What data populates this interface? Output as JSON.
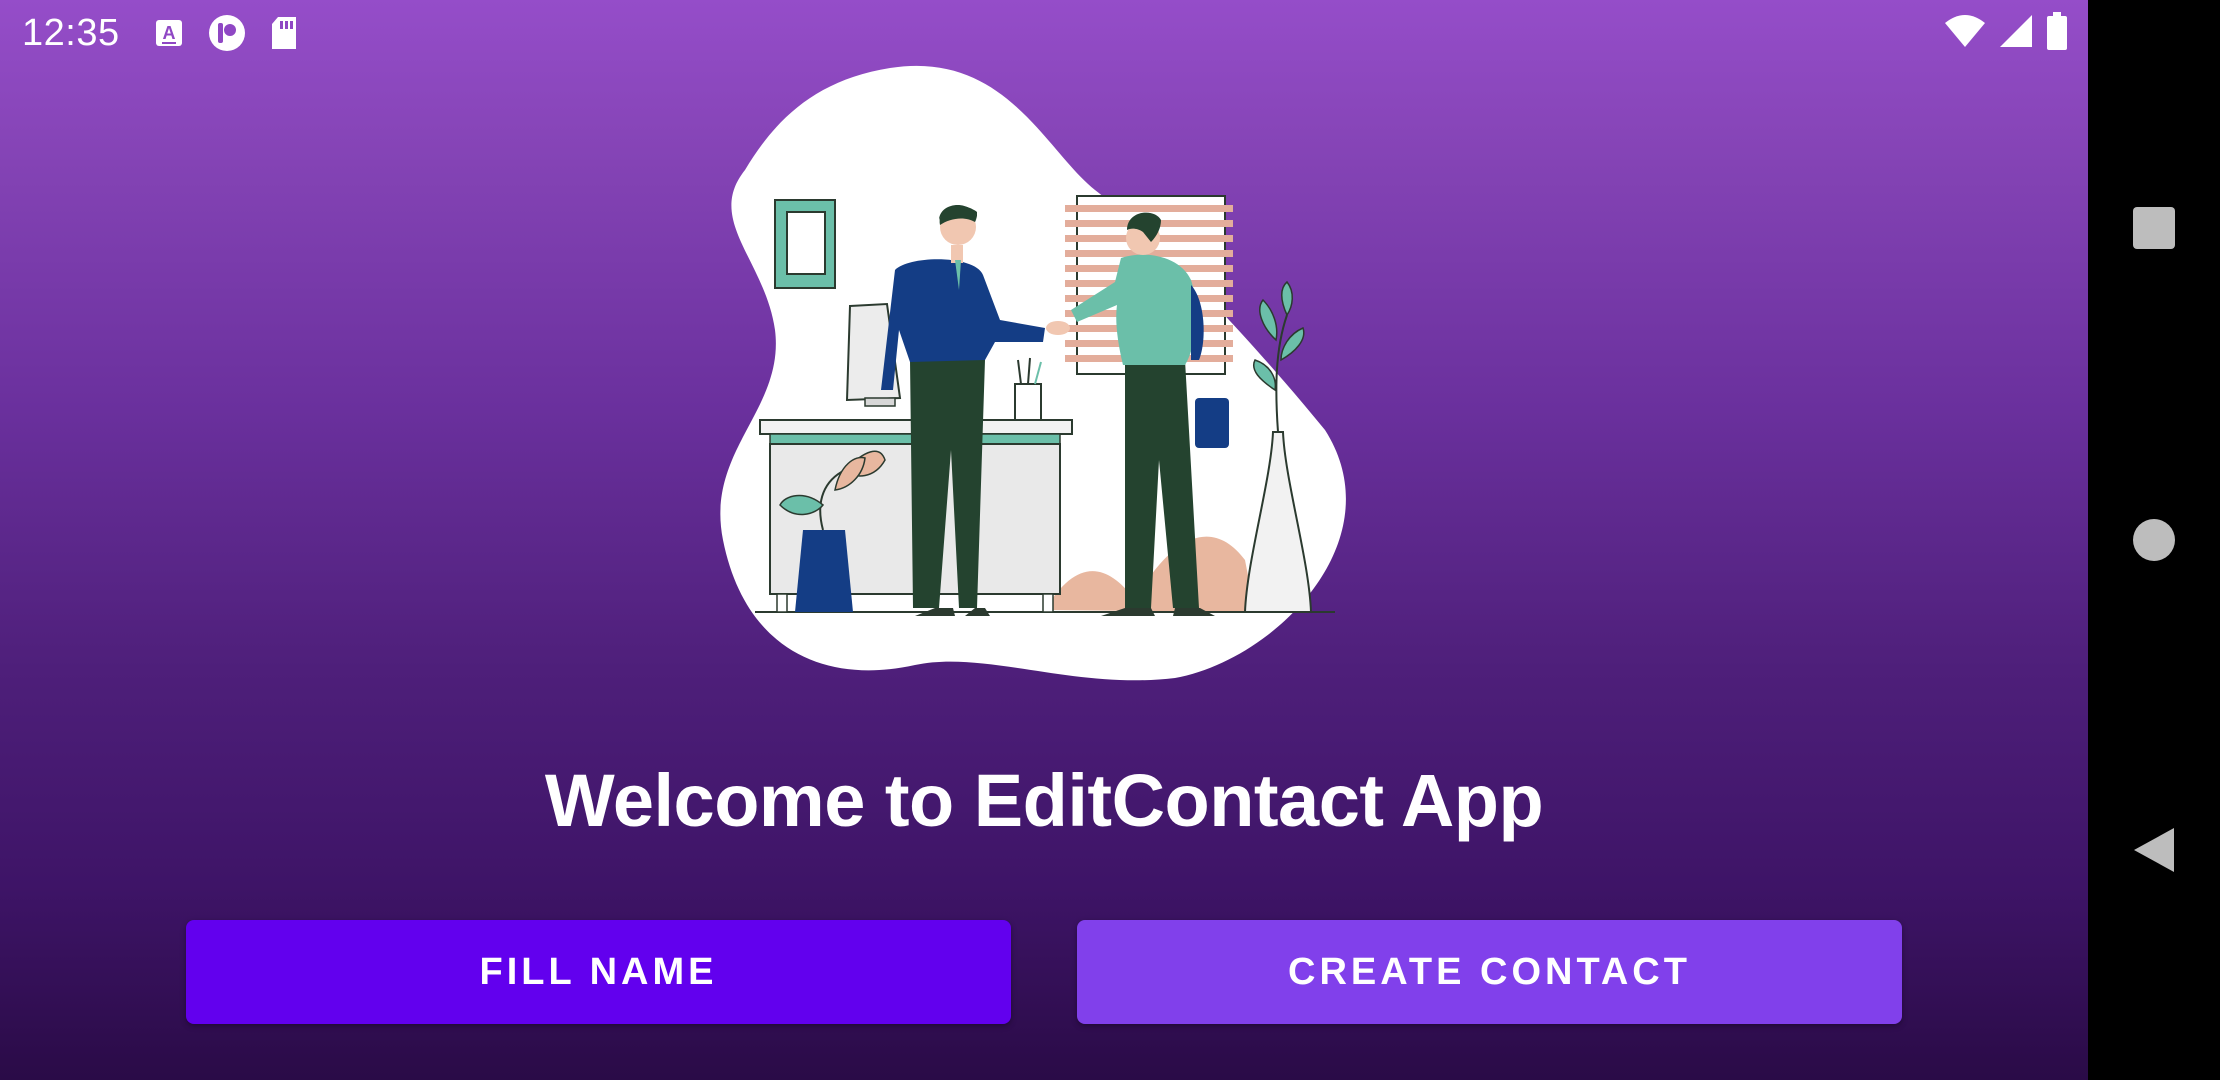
{
  "status_bar": {
    "time": "12:35",
    "left_icons": [
      "a-icon",
      "p-icon",
      "sd-card-icon"
    ],
    "right_icons": [
      "wifi-icon",
      "signal-icon",
      "battery-icon"
    ]
  },
  "illustration": {
    "description_icon": "handshake-illustration"
  },
  "welcome_text": "Welcome to EditContact App",
  "buttons": {
    "fill_name": "FILL NAME",
    "create_contact": "CREATE CONTACT"
  },
  "colors": {
    "fill_button": "#6200ee",
    "create_button": "#8140eb",
    "gradient_top": "#954dc9",
    "gradient_bottom": "#2a0b47"
  },
  "nav_bar": {
    "icons": [
      "recents-icon",
      "home-icon",
      "back-icon"
    ]
  }
}
